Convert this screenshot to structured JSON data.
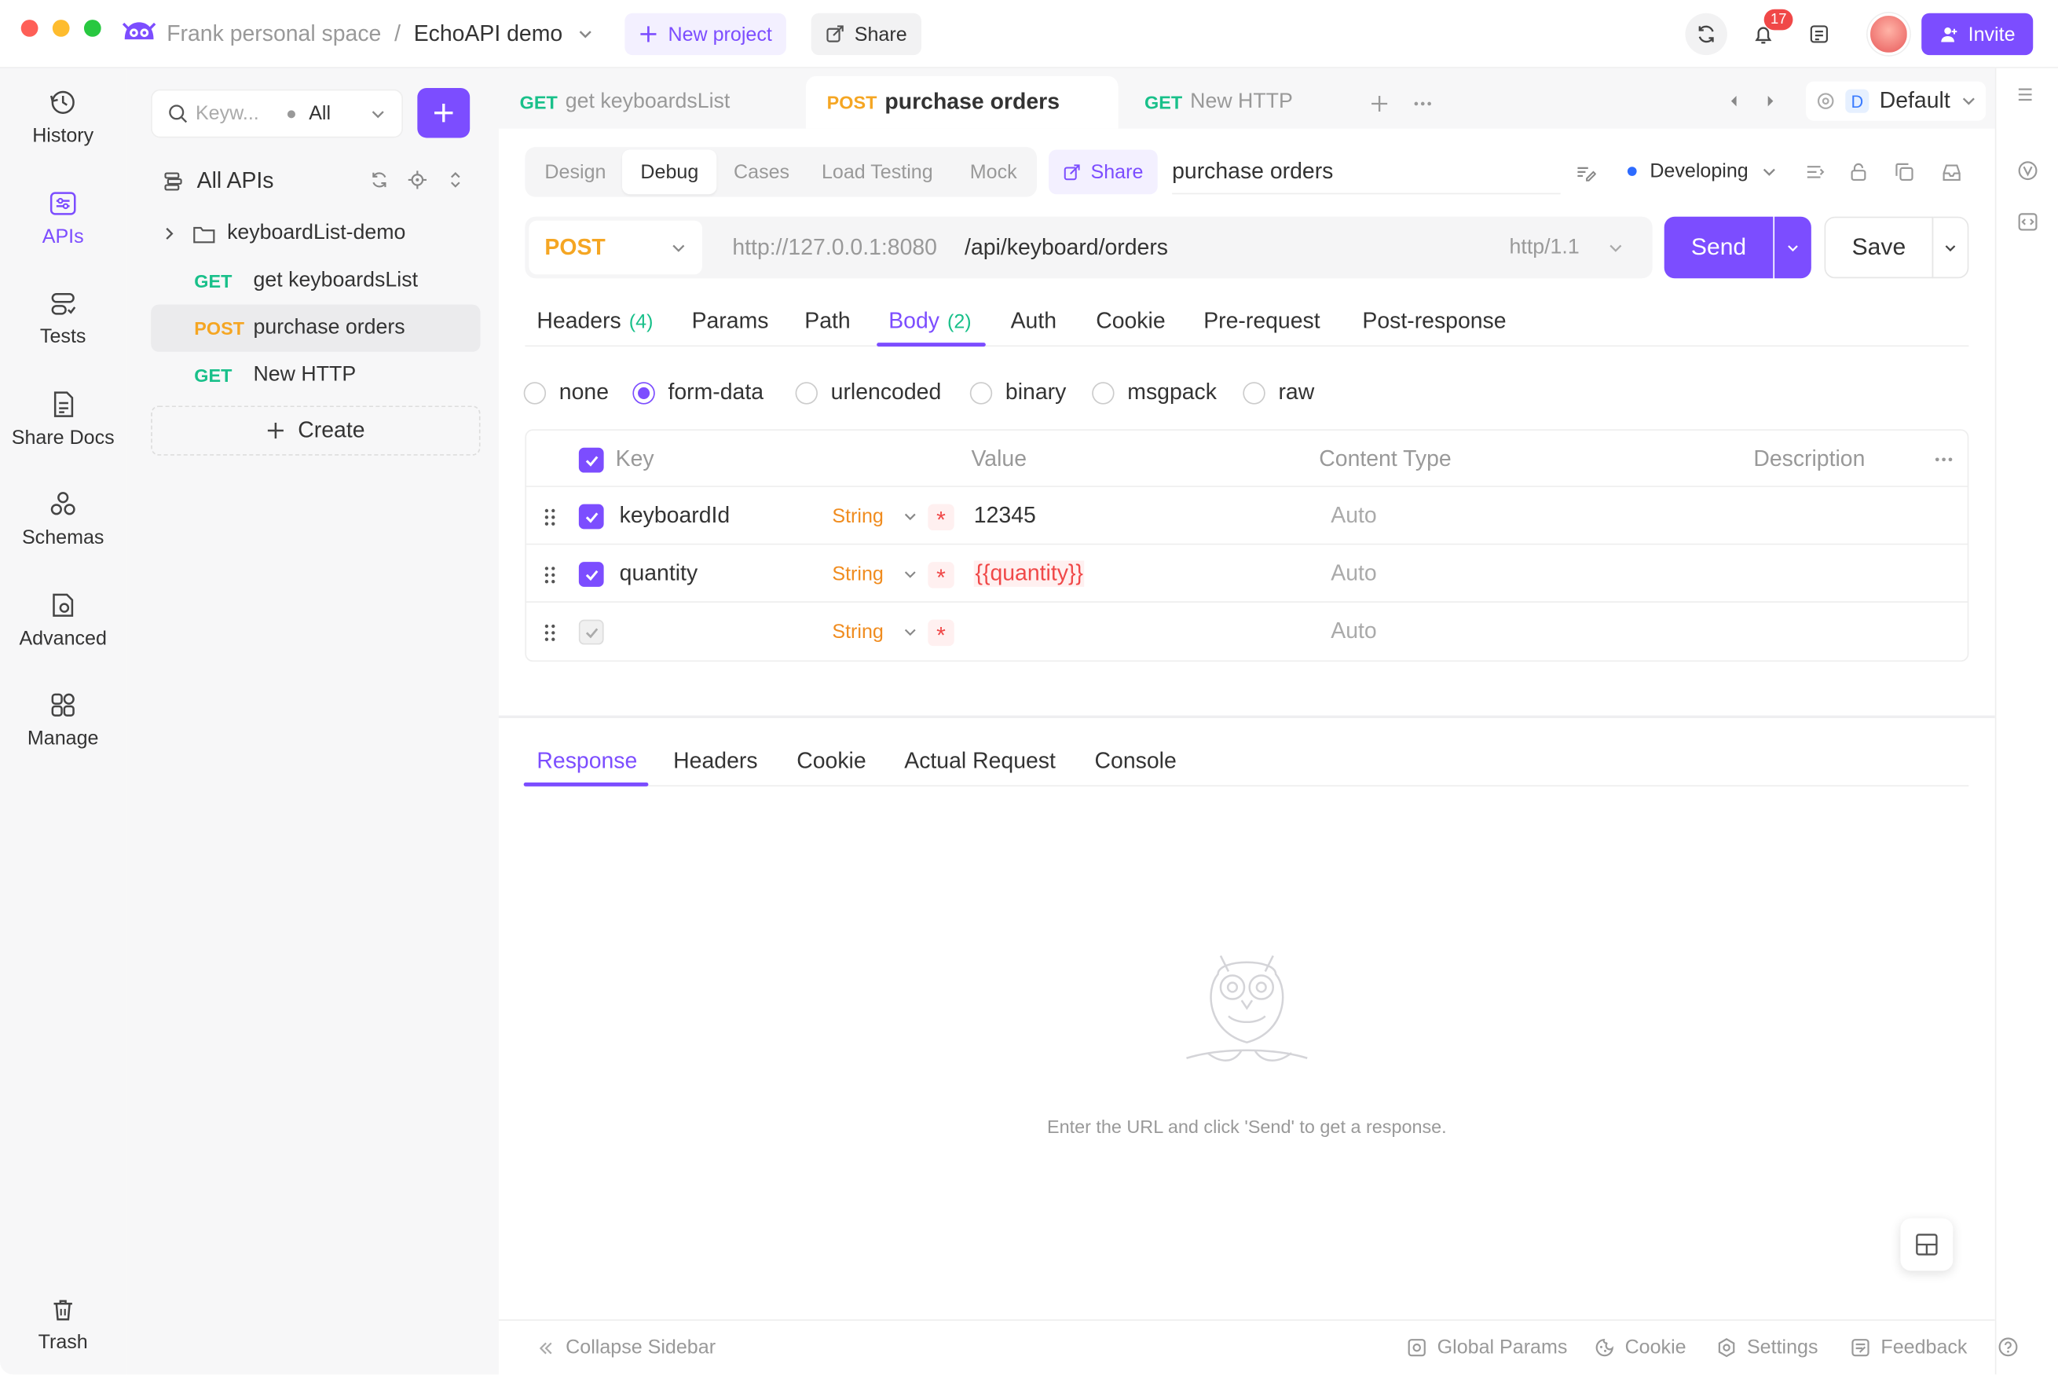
{
  "titlebar": {
    "workspace": "Frank personal space",
    "separator": "/",
    "project": "EchoAPI demo",
    "new_project": "New project",
    "share": "Share",
    "notifications_count": "17",
    "invite": "Invite"
  },
  "nav": {
    "items": [
      {
        "label": "History",
        "icon": "history-icon"
      },
      {
        "label": "APIs",
        "icon": "apis-icon",
        "active": true
      },
      {
        "label": "Tests",
        "icon": "tests-icon"
      },
      {
        "label": "Share Docs",
        "icon": "share-docs-icon"
      },
      {
        "label": "Schemas",
        "icon": "schemas-icon"
      },
      {
        "label": "Advanced",
        "icon": "advanced-icon"
      },
      {
        "label": "Manage",
        "icon": "manage-icon"
      }
    ],
    "trash": "Trash"
  },
  "tree": {
    "search_placeholder": "Keyw...",
    "filter": "All",
    "all_apis": "All APIs",
    "folder": "keyboardList-demo",
    "items": [
      {
        "method": "GET",
        "name": "get keyboardsList"
      },
      {
        "method": "POST",
        "name": "purchase orders"
      },
      {
        "method": "GET",
        "name": "New HTTP"
      }
    ],
    "create": "Create"
  },
  "tabs": [
    {
      "method": "GET",
      "name": "get keyboardsList"
    },
    {
      "method": "POST",
      "name": "purchase orders"
    },
    {
      "method": "GET",
      "name": "New HTTP"
    }
  ],
  "environment": {
    "badge": "D",
    "name": "Default"
  },
  "subtabs": [
    "Design",
    "Debug",
    "Cases",
    "Load Testing",
    "Mock"
  ],
  "share_label": "Share",
  "api_name": "purchase orders",
  "status": "Developing",
  "request": {
    "method": "POST",
    "base_url": "http://127.0.0.1:8080",
    "path": "/api/keyboard/orders",
    "protocol": "http/1.1",
    "send": "Send",
    "save": "Save"
  },
  "param_tabs": [
    {
      "label": "Headers",
      "count": "(4)"
    },
    {
      "label": "Params"
    },
    {
      "label": "Path"
    },
    {
      "label": "Body",
      "count": "(2)",
      "active": true
    },
    {
      "label": "Auth"
    },
    {
      "label": "Cookie"
    },
    {
      "label": "Pre-request"
    },
    {
      "label": "Post-response"
    }
  ],
  "body_types": [
    "none",
    "form-data",
    "urlencoded",
    "binary",
    "msgpack",
    "raw"
  ],
  "body_selected": "form-data",
  "table": {
    "headers": [
      "Key",
      "Value",
      "Content Type",
      "Description"
    ],
    "rows": [
      {
        "key": "keyboardId",
        "type": "String",
        "required": "*",
        "value": "12345",
        "content_type": "Auto"
      },
      {
        "key": "quantity",
        "type": "String",
        "required": "*",
        "value": "{{quantity}}",
        "content_type": "Auto"
      },
      {
        "key": "",
        "type": "String",
        "required": "*",
        "value": "",
        "content_type": "Auto"
      }
    ]
  },
  "response_tabs": [
    "Response",
    "Headers",
    "Cookie",
    "Actual Request",
    "Console"
  ],
  "empty_message": "Enter the URL and click 'Send' to get a response.",
  "footer": {
    "collapse": "Collapse Sidebar",
    "global_params": "Global Params",
    "cookie": "Cookie",
    "settings": "Settings",
    "feedback": "Feedback"
  },
  "colors": {
    "accent": "#7c4dff",
    "get": "#19c08a",
    "post": "#f5a623",
    "required": "#f04848"
  }
}
